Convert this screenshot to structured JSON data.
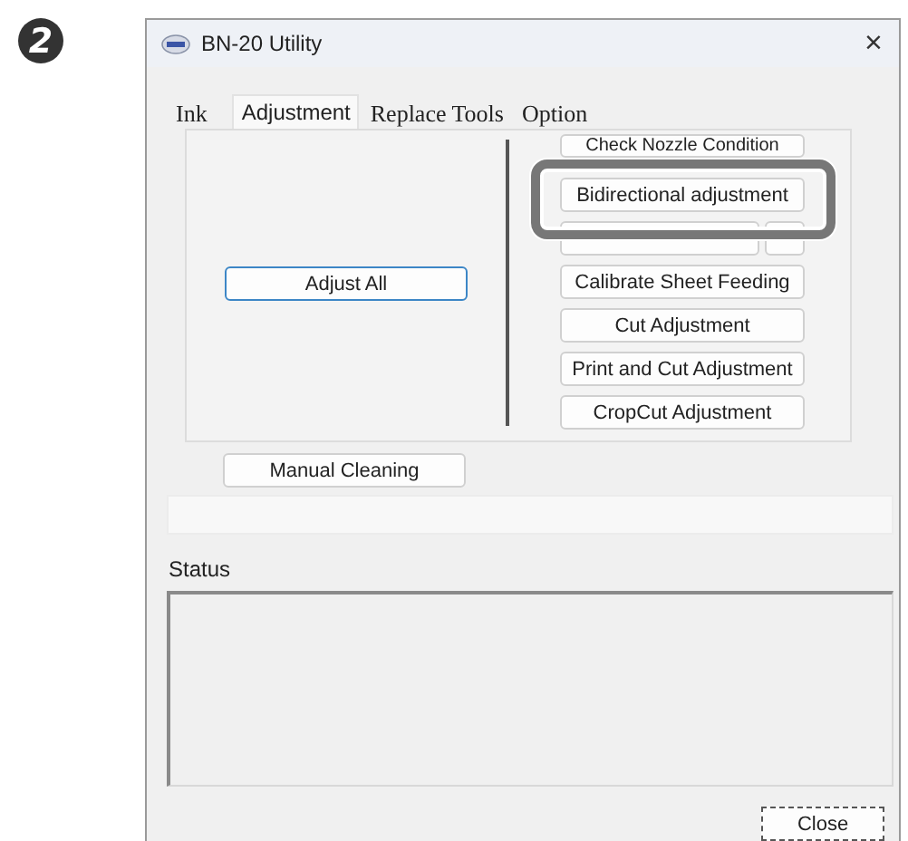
{
  "step": "2",
  "window": {
    "title": "BN-20 Utility",
    "close": "×"
  },
  "tabs": [
    {
      "label": "Ink",
      "selected": false
    },
    {
      "label": "Adjustment",
      "selected": true
    },
    {
      "label": "Replace Tools",
      "selected": false
    },
    {
      "label": "Option",
      "selected": false
    }
  ],
  "adjust_all": {
    "label": "Adjust All",
    "default": true
  },
  "adjustment_buttons": [
    {
      "kind": "clipped",
      "label": "Check Nozzle Condition"
    },
    {
      "kind": "normal",
      "label": "Bidirectional adjustment",
      "highlighted": true
    },
    {
      "kind": "covered"
    },
    {
      "kind": "normal",
      "label": "Calibrate Sheet Feeding"
    },
    {
      "kind": "normal",
      "label": "Cut Adjustment"
    },
    {
      "kind": "normal",
      "label": "Print and Cut Adjustment"
    },
    {
      "kind": "normal",
      "label": "CropCut Adjustment"
    }
  ],
  "manual_cleaning": {
    "label": "Manual Cleaning"
  },
  "status": {
    "label": "Status"
  },
  "close_button": {
    "label": "Close",
    "focused": true
  }
}
